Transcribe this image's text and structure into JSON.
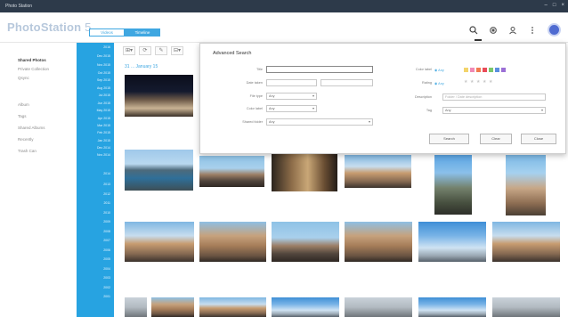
{
  "window": {
    "title": "Photo Station",
    "controls": [
      "–",
      "□",
      "×"
    ]
  },
  "header": {
    "logo_main": "PhotoStation",
    "logo_version": "5",
    "view_tabs": [
      {
        "label": "Videos",
        "active": false
      },
      {
        "label": "Timeline",
        "active": true
      }
    ],
    "icons": [
      "search-icon",
      "refresh-icon",
      "user-icon",
      "more-icon"
    ]
  },
  "sidebar": {
    "items": [
      {
        "label": "Shared Photos",
        "active": true
      },
      {
        "label": "Private Collection",
        "active": false
      },
      {
        "label": "Qsync",
        "active": false
      },
      {
        "label": "Album",
        "active": false
      },
      {
        "label": "Tags",
        "active": false
      },
      {
        "label": "Shared Albums",
        "active": false
      },
      {
        "label": "Recently",
        "active": false
      },
      {
        "label": "Trash Can",
        "active": false
      }
    ]
  },
  "timeline": {
    "labels": [
      "2016",
      "Dec 2015",
      "Nov 2015",
      "Oct 2015",
      "Sep 2015",
      "Aug 2015",
      "Jul 2015",
      "Jun 2015",
      "May 2015",
      "Apr 2015",
      "Mar 2015",
      "Feb 2015",
      "Jan 2015",
      "Dec 2014",
      "Nov 2014",
      "2014",
      "2013",
      "2012",
      "2011",
      "2010",
      "2009",
      "2008",
      "2007",
      "2006",
      "2005",
      "2004",
      "2003",
      "2002",
      "2001"
    ]
  },
  "toolbar": {
    "buttons": [
      "⊞▾",
      "⟳",
      "✎",
      "⊟▾"
    ]
  },
  "content": {
    "date_label": "31 ... January 15"
  },
  "advanced_search": {
    "title": "Advanced Search",
    "fields": {
      "title": {
        "label": "Title",
        "value": ""
      },
      "date_taken": {
        "label": "Date taken",
        "from": "",
        "to": ""
      },
      "file_type": {
        "label": "File type",
        "value": "Any"
      },
      "color_label_type": {
        "label": "Color label",
        "value": "Any"
      },
      "shared_folder": {
        "label": "Shared folder",
        "value": "Any"
      },
      "color_label": {
        "label": "Color label",
        "radio": "Any"
      },
      "rating": {
        "label": "Rating",
        "radio": "Any"
      },
      "description": {
        "label": "Description",
        "placeholder": "Folder / Date description"
      },
      "tag": {
        "label": "Tag",
        "value": "Any"
      }
    },
    "swatch_colors": [
      "#f3d46b",
      "#f08ab6",
      "#f17b4f",
      "#e94c59",
      "#7bc76b",
      "#5b8fe0",
      "#9b6fd6"
    ],
    "buttons": {
      "search": "Search",
      "clear": "Clear",
      "close": "Close"
    }
  }
}
